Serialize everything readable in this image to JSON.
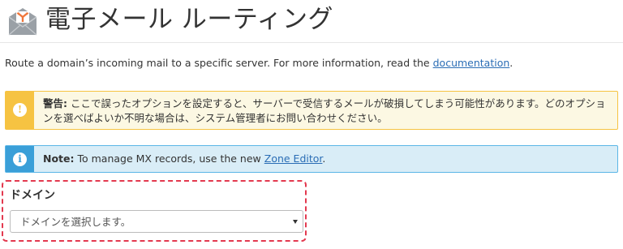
{
  "header": {
    "title": "電子メール ルーティング",
    "icon": "email-routing-icon"
  },
  "description": {
    "text": "Route a domain’s incoming mail to a specific server. For more information, read the ",
    "link": "documentation",
    "suffix": "."
  },
  "warning_alert": {
    "label": "警告:",
    "text": " ここで誤ったオプションを設定すると、サーバーで受信するメールが破損してしまう可能性があります。どのオプションを選べばよいか不明な場合は、システム管理者にお問い合わせください。",
    "icon": "exclamation-icon",
    "color": "#f6c342"
  },
  "info_alert": {
    "label": "Note:",
    "text": " To manage MX records, use the new ",
    "link": "Zone Editor",
    "suffix": ".",
    "icon": "info-icon",
    "color": "#3a9fd8"
  },
  "domain": {
    "label": "ドメイン",
    "select_value": "ドメインを選択します。",
    "highlight_color": "#e3394f"
  }
}
